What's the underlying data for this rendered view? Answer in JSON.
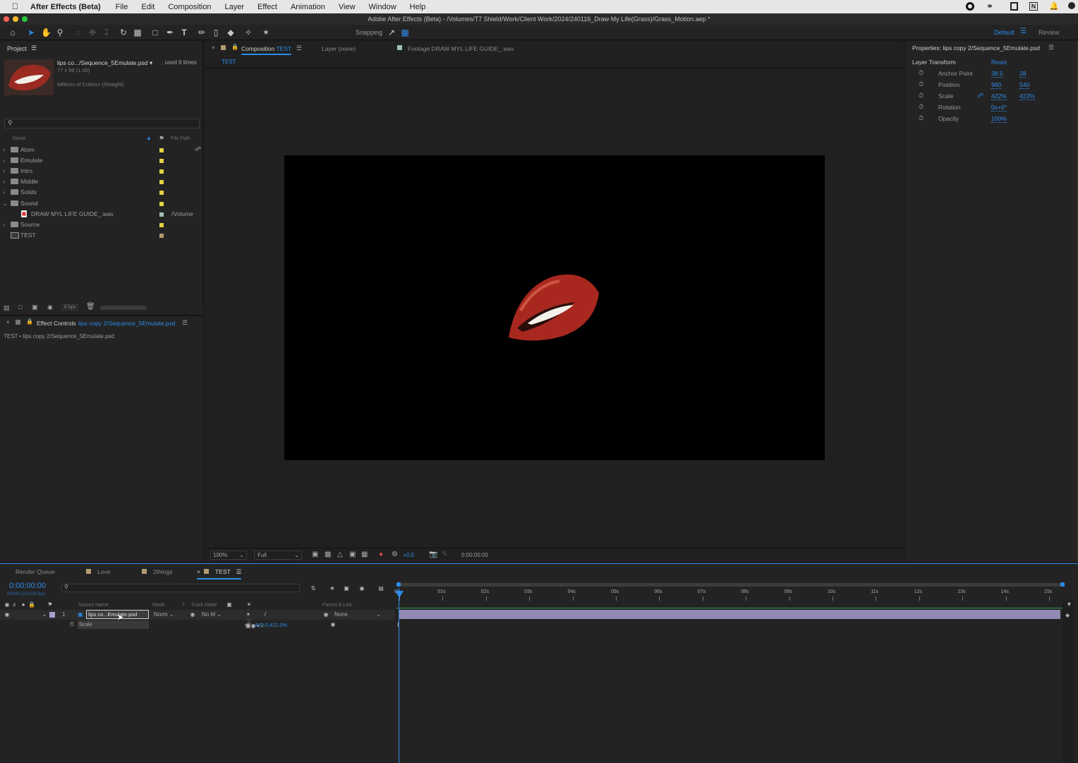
{
  "menubar": {
    "app": "After Effects (Beta)",
    "items": [
      "File",
      "Edit",
      "Composition",
      "Layer",
      "Effect",
      "Animation",
      "View",
      "Window",
      "Help"
    ]
  },
  "window": {
    "title": "Adobe After Effects (Beta) - /Volumes/T7 Shield/Work/Client Work/2024/240116_Draw My Life(Grass)/Grass_Motion.aep *"
  },
  "toolbar": {
    "snapping": "Snapping",
    "workspace": "Default",
    "review": "Review"
  },
  "project": {
    "title": "Project",
    "asset_name": "lips co.../Sequence_5Emulate.psd ▾",
    "asset_used": ", used 9 times",
    "asset_dims": "77 x 56 (1.00)",
    "asset_colors": "Millions of Colors+ (Straight)",
    "col_name": "Name",
    "col_path": "File Path",
    "items": [
      {
        "name": "Atom",
        "type": "folder",
        "color": "#e3d245",
        "path": ""
      },
      {
        "name": "Emulate",
        "type": "folder",
        "color": "#e3d245",
        "path": ""
      },
      {
        "name": "Intro",
        "type": "folder",
        "color": "#e3d245",
        "path": ""
      },
      {
        "name": "Middle",
        "type": "folder",
        "color": "#e3d245",
        "path": ""
      },
      {
        "name": "Solids",
        "type": "folder",
        "color": "#e3d245",
        "path": ""
      },
      {
        "name": "Sound",
        "type": "folder-open",
        "color": "#e3d245",
        "path": ""
      },
      {
        "name": "DRAW MYL LIFE GUIDE_.wav",
        "type": "audio",
        "color": "#9fc0b2",
        "path": "/Volume"
      },
      {
        "name": "Source",
        "type": "folder",
        "color": "#e3d245",
        "path": ""
      },
      {
        "name": "TEST",
        "type": "comp",
        "color": "#b19b73",
        "path": ""
      }
    ],
    "bpc": "8 bpc"
  },
  "effect_controls": {
    "label": "Effect Controls",
    "layer": "lips copy 2/Sequence_5Emulate.psd",
    "sub": "TEST • lips copy 2/Sequence_5Emulate.psd"
  },
  "comp": {
    "tab_label": "Composition",
    "tab_name": "TEST",
    "layer_tab": "Layer (none)",
    "footage_tab": "Footage DRAW MYL LIFE GUIDE_.wav",
    "breadcrumb": "TEST",
    "zoom": "100%",
    "resolution": "Full",
    "exposure": "+0.0",
    "timecode": "0:00:00:00"
  },
  "properties": {
    "title": "Properties: lips copy 2/Sequence_5Emulate.psd",
    "section": "Layer Transform",
    "reset": "Reset",
    "rows": [
      {
        "name": "Anchor Point",
        "v1": "38.5",
        "v2": "28"
      },
      {
        "name": "Position",
        "v1": "960",
        "v2": "540"
      },
      {
        "name": "Scale",
        "v1": "422%",
        "v2": "422%"
      },
      {
        "name": "Rotation",
        "v1": "0x+0°",
        "v2": ""
      },
      {
        "name": "Opacity",
        "v1": "100%",
        "v2": ""
      }
    ]
  },
  "timeline": {
    "tabs": [
      "Render Queue",
      "Love",
      "2things",
      "TEST"
    ],
    "timecode": "0:00:00:00",
    "fps": "00000 (23.976 fps)",
    "col_source": "Source Name",
    "col_mode": "Mode",
    "col_t": "T",
    "col_track": "Track Matte",
    "col_parent": "Parent & Link",
    "layer": {
      "num": "1",
      "name": "lips co...Emulate.psd",
      "mode": "Norm",
      "matte": "No M",
      "parent": "None"
    },
    "prop": {
      "name": "Scale",
      "value": "422.0,422.0%"
    },
    "ruler": [
      "0s",
      "01s",
      "02s",
      "03s",
      "04s",
      "05s",
      "06s",
      "07s",
      "08s",
      "09s",
      "10s",
      "11s",
      "12s",
      "13s",
      "14s",
      "15s"
    ]
  }
}
